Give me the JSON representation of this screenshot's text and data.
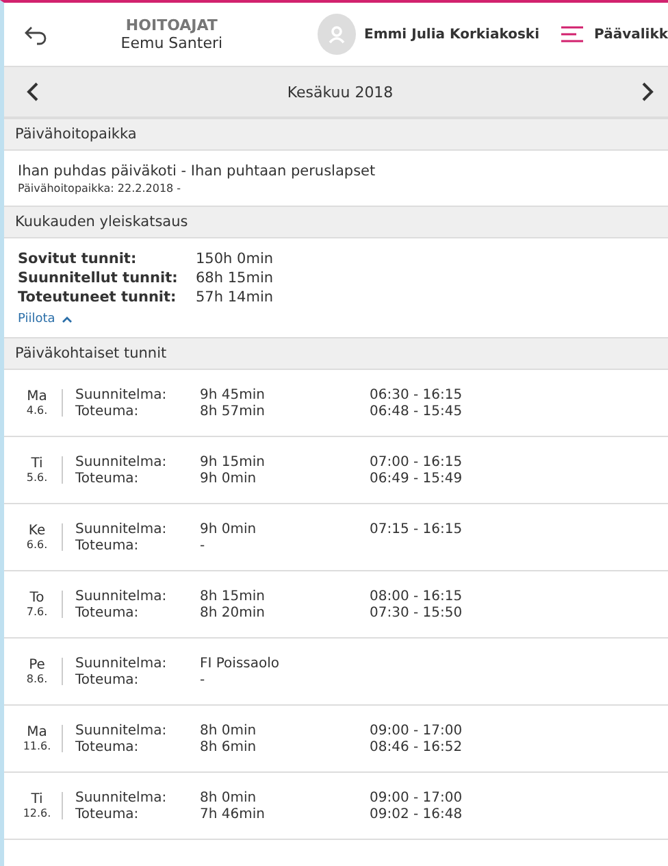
{
  "header": {
    "title": "HOITOAJAT",
    "subtitle": "Eemu Santeri",
    "user_name": "Emmi Julia Korkiakoski",
    "menu_label": "Päävalikk"
  },
  "month_nav": {
    "label": "Kesäkuu 2018"
  },
  "daycare": {
    "heading": "Päivähoitopaikka",
    "name": "Ihan puhdas päiväkoti - Ihan puhtaan peruslapset",
    "detail": "Päivähoitopaikka: 22.2.2018 -"
  },
  "overview": {
    "heading": "Kuukauden yleiskatsaus",
    "expanded": true,
    "rows": [
      {
        "label": "Sovitut tunnit:",
        "value": "150h 0min"
      },
      {
        "label": "Suunnitellut tunnit:",
        "value": "68h 15min"
      },
      {
        "label": "Toteutuneet tunnit:",
        "value": "57h 14min"
      }
    ],
    "toggle_label": "Piilota"
  },
  "daily": {
    "heading": "Päiväkohtaiset tunnit",
    "days": [
      {
        "weekday": "Ma",
        "date": "4.6.",
        "plan_label": "Suunnitelma:",
        "plan_duration": "9h 45min",
        "plan_time": "06:30 - 16:15",
        "actual_label": "Toteuma:",
        "actual_duration": "8h 57min",
        "actual_time": "06:48 - 15:45"
      },
      {
        "weekday": "Ti",
        "date": "5.6.",
        "plan_label": "Suunnitelma:",
        "plan_duration": "9h 15min",
        "plan_time": "07:00 - 16:15",
        "actual_label": "Toteuma:",
        "actual_duration": "9h 0min",
        "actual_time": "06:49 - 15:49"
      },
      {
        "weekday": "Ke",
        "date": "6.6.",
        "plan_label": "Suunnitelma:",
        "plan_duration": "9h 0min",
        "plan_time": "07:15 - 16:15",
        "actual_label": "Toteuma:",
        "actual_duration": "-"
      },
      {
        "weekday": "To",
        "date": "7.6.",
        "plan_label": "Suunnitelma:",
        "plan_duration": "8h 15min",
        "plan_time": "08:00 - 16:15",
        "actual_label": "Toteuma:",
        "actual_duration": "8h 20min",
        "actual_time": "07:30 - 15:50"
      },
      {
        "weekday": "Pe",
        "date": "8.6.",
        "plan_label": "Suunnitelma:",
        "plan_duration": "FI Poissaolo",
        "actual_label": "Toteuma:",
        "actual_duration": "-"
      },
      {
        "weekday": "Ma",
        "date": "11.6.",
        "plan_label": "Suunnitelma:",
        "plan_duration": "8h 0min",
        "plan_time": "09:00 - 17:00",
        "actual_label": "Toteuma:",
        "actual_duration": "8h 6min",
        "actual_time": "08:46 - 16:52"
      },
      {
        "weekday": "Ti",
        "date": "12.6.",
        "plan_label": "Suunnitelma:",
        "plan_duration": "8h 0min",
        "plan_time": "09:00 - 17:00",
        "actual_label": "Toteuma:",
        "actual_duration": "7h 46min",
        "actual_time": "09:02 - 16:48"
      }
    ]
  }
}
